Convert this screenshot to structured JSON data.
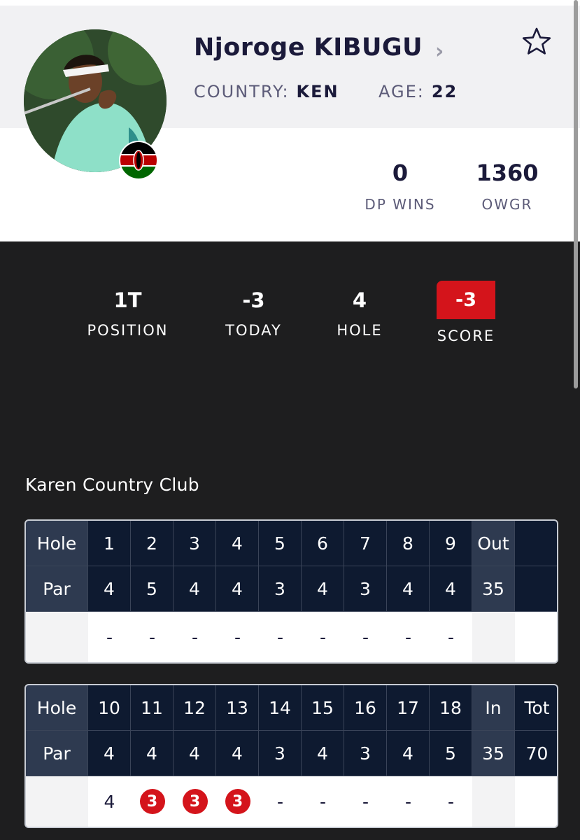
{
  "player": {
    "name": "Njoroge KIBUGU",
    "country_label": "COUNTRY:",
    "country": "KEN",
    "age_label": "AGE:",
    "age": "22",
    "avatar_icon": "player-photo",
    "flag_icon": "kenya-flag-icon",
    "favorite_icon": "star-outline-icon"
  },
  "career_stats": {
    "dp_wins": "0",
    "dp_wins_label": "DP WINS",
    "owgr": "1360",
    "owgr_label": "OWGR"
  },
  "tournament": {
    "position": "1T",
    "position_label": "POSITION",
    "today": "-3",
    "today_label": "TODAY",
    "hole": "4",
    "hole_label": "HOLE",
    "score": "-3",
    "score_label": "SCORE"
  },
  "course_name": "Karen Country Club",
  "front_nine": {
    "hole_label": "Hole",
    "par_label": "Par",
    "holes": [
      "1",
      "2",
      "3",
      "4",
      "5",
      "6",
      "7",
      "8",
      "9"
    ],
    "pars": [
      "4",
      "5",
      "4",
      "4",
      "3",
      "4",
      "3",
      "4",
      "4"
    ],
    "scores": [
      "-",
      "-",
      "-",
      "-",
      "-",
      "-",
      "-",
      "-",
      "-"
    ],
    "total_label": "Out",
    "total_par": "35",
    "total_score": ""
  },
  "back_nine": {
    "hole_label": "Hole",
    "par_label": "Par",
    "holes": [
      "10",
      "11",
      "12",
      "13",
      "14",
      "15",
      "16",
      "17",
      "18"
    ],
    "pars": [
      "4",
      "4",
      "4",
      "4",
      "3",
      "4",
      "3",
      "4",
      "5"
    ],
    "scores": [
      "4",
      "3",
      "3",
      "3",
      "-",
      "-",
      "-",
      "-",
      "-"
    ],
    "birdies": [
      false,
      true,
      true,
      true,
      false,
      false,
      false,
      false,
      false
    ],
    "total_label": "In",
    "total_par": "35",
    "tot_label": "Tot",
    "tot_par": "70"
  },
  "colors": {
    "navy": "#1b1a3a",
    "card_dark": "#0e1a30",
    "card_mid": "#2e3a50",
    "birdie_red": "#d4141b",
    "background": "#1e1e1f"
  }
}
